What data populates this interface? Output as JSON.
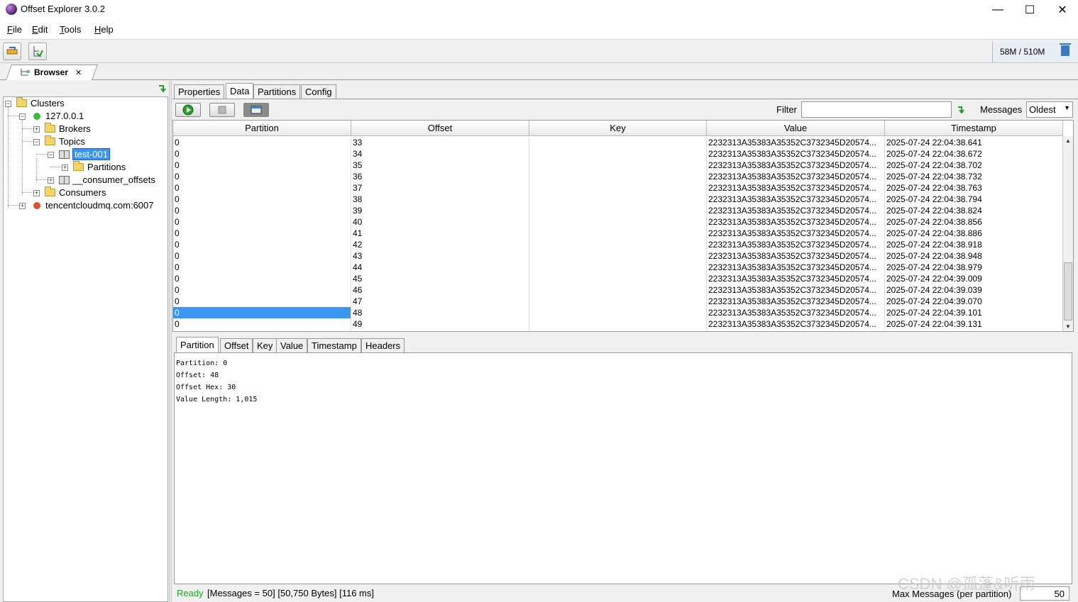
{
  "window": {
    "title": "Offset Explorer  3.0.2",
    "minimize": "—",
    "maximize": "☐",
    "close": "✕"
  },
  "menu": [
    "File",
    "Edit",
    "Tools",
    "Help"
  ],
  "memory": "58M / 510M",
  "browser_tab": {
    "label": "Browser",
    "close": "✕"
  },
  "tree": {
    "clusters": "Clusters",
    "host": "127.0.0.1",
    "brokers": "Brokers",
    "topics": "Topics",
    "topic_selected": "test-001",
    "partitions": "Partitions",
    "consumer_offsets": "__consumer_offsets",
    "consumers": "Consumers",
    "remote": "tencentcloudmq.com:6007"
  },
  "tabs": [
    "Properties",
    "Data",
    "Partitions",
    "Config"
  ],
  "filter": {
    "label": "Filter",
    "value": ""
  },
  "messages": {
    "label": "Messages",
    "selected": "Oldest"
  },
  "columns": [
    "Partition",
    "Offset",
    "Key",
    "Value",
    "Timestamp"
  ],
  "rows": [
    [
      "0",
      "33",
      "",
      "2232313A35383A35352C3732345D20574...",
      "2025-07-24 22:04:38.641"
    ],
    [
      "0",
      "34",
      "",
      "2232313A35383A35352C3732345D20574...",
      "2025-07-24 22:04:38.672"
    ],
    [
      "0",
      "35",
      "",
      "2232313A35383A35352C3732345D20574...",
      "2025-07-24 22:04:38.702"
    ],
    [
      "0",
      "36",
      "",
      "2232313A35383A35352C3732345D20574...",
      "2025-07-24 22:04:38.732"
    ],
    [
      "0",
      "37",
      "",
      "2232313A35383A35352C3732345D20574...",
      "2025-07-24 22:04:38.763"
    ],
    [
      "0",
      "38",
      "",
      "2232313A35383A35352C3732345D20574...",
      "2025-07-24 22:04:38.794"
    ],
    [
      "0",
      "39",
      "",
      "2232313A35383A35352C3732345D20574...",
      "2025-07-24 22:04:38.824"
    ],
    [
      "0",
      "40",
      "",
      "2232313A35383A35352C3732345D20574...",
      "2025-07-24 22:04:38.856"
    ],
    [
      "0",
      "41",
      "",
      "2232313A35383A35352C3732345D20574...",
      "2025-07-24 22:04:38.886"
    ],
    [
      "0",
      "42",
      "",
      "2232313A35383A35352C3732345D20574...",
      "2025-07-24 22:04:38.918"
    ],
    [
      "0",
      "43",
      "",
      "2232313A35383A35352C3732345D20574...",
      "2025-07-24 22:04:38.948"
    ],
    [
      "0",
      "44",
      "",
      "2232313A35383A35352C3732345D20574...",
      "2025-07-24 22:04:38.979"
    ],
    [
      "0",
      "45",
      "",
      "2232313A35383A35352C3732345D20574...",
      "2025-07-24 22:04:39.009"
    ],
    [
      "0",
      "46",
      "",
      "2232313A35383A35352C3732345D20574...",
      "2025-07-24 22:04:39.039"
    ],
    [
      "0",
      "47",
      "",
      "2232313A35383A35352C3732345D20574...",
      "2025-07-24 22:04:39.070"
    ],
    [
      "0",
      "48",
      "",
      "2232313A35383A35352C3732345D20574...",
      "2025-07-24 22:04:39.101"
    ],
    [
      "0",
      "49",
      "",
      "2232313A35383A35352C3732345D20574...",
      "2025-07-24 22:04:39.131"
    ]
  ],
  "selected_row": 15,
  "detail_tabs": [
    "Partition",
    "Offset",
    "Key",
    "Value",
    "Timestamp",
    "Headers"
  ],
  "detail_lines": [
    "Partition: 0",
    "Offset: 48",
    "Offset Hex: 30",
    "Value Length: 1,015"
  ],
  "status": {
    "ready": "Ready",
    "info": "[Messages = 50]  [50,750 Bytes]  [116 ms]",
    "max_label": "Max Messages (per partition)",
    "max_value": "50"
  },
  "watermark": "CSDN @孤蓬&听雨",
  "colors": {
    "selection": "#3a96f0",
    "ready": "#22aa22",
    "connected": "#3cba3c",
    "disconnected": "#e2502a"
  }
}
